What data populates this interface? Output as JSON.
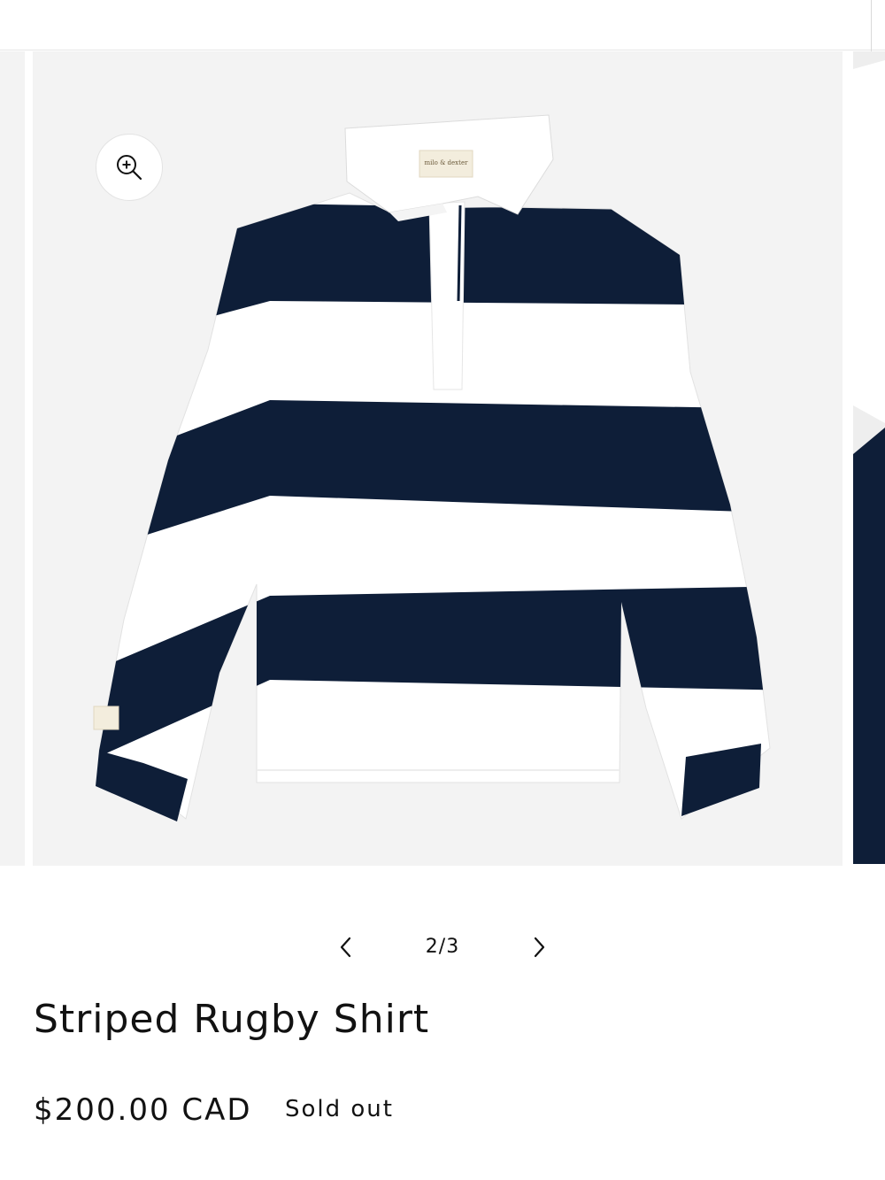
{
  "gallery": {
    "counter": "2/3",
    "brand_label": "milo & dexter",
    "colors": {
      "navy": "#0e1e38",
      "white": "#ffffff",
      "background": "#f3f3f3"
    }
  },
  "product": {
    "title": "Striped Rugby Shirt",
    "price": "$200.00 CAD",
    "availability": "Sold out"
  },
  "icons": {
    "zoom": "zoom-in-icon",
    "prev": "chevron-left-icon",
    "next": "chevron-right-icon"
  }
}
